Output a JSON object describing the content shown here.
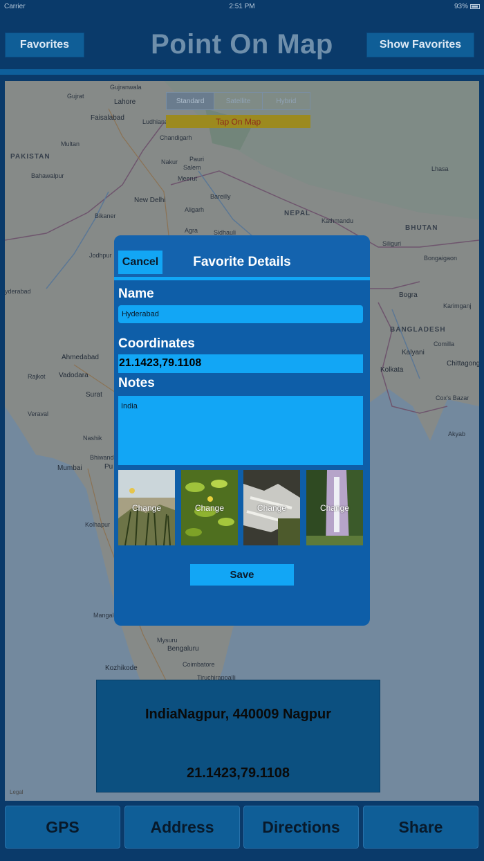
{
  "status_bar": {
    "carrier": "Carrier",
    "time": "2:51 PM",
    "battery": "93%"
  },
  "header": {
    "title": "Point On Map",
    "favorites_label": "Favorites",
    "show_favorites_label": "Show Favorites"
  },
  "map": {
    "segments": [
      {
        "label": "Standard",
        "selected": true
      },
      {
        "label": "Satellite",
        "selected": false
      },
      {
        "label": "Hybrid",
        "selected": false
      }
    ],
    "tap_banner": "Tap On Map",
    "labels": {
      "gujranwala": "Gujranwala",
      "lahore": "Lahore",
      "gujrat": "Gujrat",
      "faisalabad": "Faisalabad",
      "ludhiana": "Ludhiana",
      "chandigarh": "Chandigarh",
      "multan": "Multan",
      "pakistan": "PAKISTAN",
      "bahawalpur": "Bahawalpur",
      "nakur": "Nakur",
      "pauri": "Pauri",
      "salem": "Salem",
      "meerut": "Meerut",
      "bareilly": "Bareilly",
      "new_delhi": "New Delhi",
      "lhasa": "Lhasa",
      "aligarh": "Aligarh",
      "bikaner": "Bikaner",
      "nepal": "NEPAL",
      "kathmandu": "Kathmandu",
      "bhutan": "BHUTAN",
      "agra": "Agra",
      "sidhauli": "Sidhauli",
      "siliguri": "Siliguri",
      "bongaigaon": "Bongaigaon",
      "jodhpur": "Jodhpur",
      "hyderabad_pk": "yderabad",
      "bogra": "Bogra",
      "karimganj": "Karimganj",
      "bangladesh": "BANGLADESH",
      "comilla": "Comilla",
      "ahmedabad": "Ahmedabad",
      "kalyani": "Kalyani",
      "kolkata": "Kolkata",
      "chittagong": "Chittagong",
      "rajkot": "Rajkot",
      "vadodara": "Vadodara",
      "surat": "Surat",
      "coxs_bazar": "Cox's Bazar",
      "veraval": "Veraval",
      "akyab": "Akyab",
      "nashik": "Nashik",
      "bhiwandi": "Bhiwandi",
      "mumbai": "Mumbai",
      "pune": "Pu",
      "kolhapur": "Kolhapur",
      "mangalore": "Mangalo",
      "mysuru": "Mysuru",
      "bengaluru": "Bengaluru",
      "kozhikode": "Kozhikode",
      "coimbatore": "Coimbatore",
      "tiruchirappalli": "Tiruchirappalli"
    },
    "legal": "Legal"
  },
  "address_panel": {
    "address": "IndiaNagpur, 440009 Nagpur",
    "coordinates": "21.1423,79.1108"
  },
  "modal": {
    "title": "Favorite Details",
    "cancel_label": "Cancel",
    "name_label": "Name",
    "name_value": "Hyderabad",
    "coordinates_label": "Coordinates",
    "coordinates_value": "21.1423,79.1108",
    "notes_label": "Notes",
    "notes_value": "India",
    "photos": [
      {
        "name": "grass-photo",
        "change_label": "Change"
      },
      {
        "name": "leaves-photo",
        "change_label": "Change"
      },
      {
        "name": "rapids-photo",
        "change_label": "Change"
      },
      {
        "name": "waterfall-photo",
        "change_label": "Change"
      }
    ],
    "save_label": "Save"
  },
  "bottom_bar": [
    {
      "name": "gps-button",
      "label": "GPS"
    },
    {
      "name": "address-button",
      "label": "Address"
    },
    {
      "name": "directions-button",
      "label": "Directions"
    },
    {
      "name": "share-button",
      "label": "Share"
    }
  ]
}
